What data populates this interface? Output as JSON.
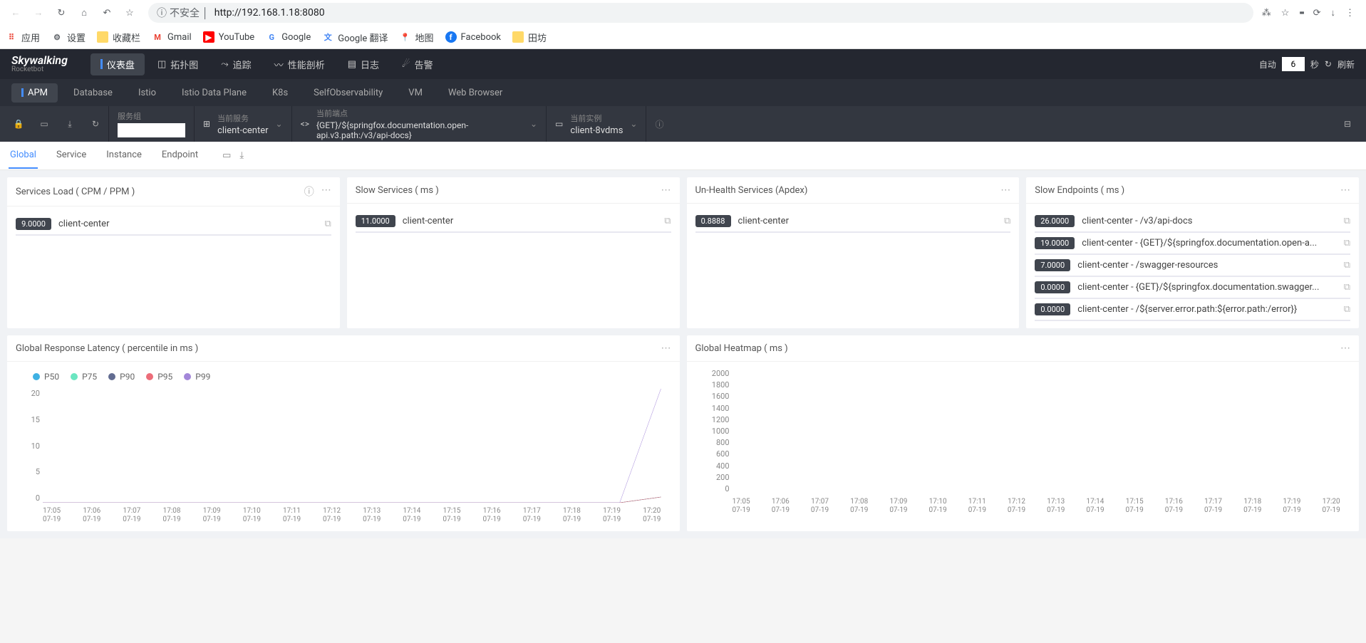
{
  "browser": {
    "insecure_label": "不安全",
    "url": "http://192.168.1.18:8080",
    "bookmarks": {
      "apps": "应用",
      "settings": "设置",
      "favorites": "收藏栏",
      "gmail": "Gmail",
      "youtube": "YouTube",
      "google": "Google",
      "gtranslate": "Google 翻译",
      "map": "地图",
      "facebook": "Facebook",
      "tiantan": "田坊"
    }
  },
  "header": {
    "logo_main": "Skywalking",
    "logo_sub": "Rocketbot",
    "tabs": {
      "dashboard": "仪表盘",
      "topology": "拓扑图",
      "trace": "追踪",
      "profile": "性能剖析",
      "log": "日志",
      "alarm": "告警"
    },
    "auto_label": "自动",
    "interval_value": "6",
    "seconds_label": "秒",
    "refresh_label": "刷新"
  },
  "subnav": {
    "apm": "APM",
    "database": "Database",
    "istio": "Istio",
    "istio_dp": "Istio Data Plane",
    "k8s": "K8s",
    "self": "SelfObservability",
    "vm": "VM",
    "web": "Web Browser"
  },
  "selectors": {
    "group_label": "服务组",
    "group_value": "",
    "service_label": "当前服务",
    "service_value": "client-center",
    "endpoint_label": "当前端点",
    "endpoint_value": "{GET}/${springfox.documentation.open-api.v3.path:/v3/api-docs}",
    "instance_label": "当前实例",
    "instance_value": "client-8vdms"
  },
  "page_tabs": {
    "global": "Global",
    "service": "Service",
    "instance": "Instance",
    "endpoint": "Endpoint"
  },
  "cards": {
    "services_load": {
      "title": "Services Load ( CPM / PPM )",
      "items": [
        {
          "value": "9.0000",
          "name": "client-center",
          "pct": 100
        }
      ]
    },
    "slow_services": {
      "title": "Slow Services ( ms )",
      "items": [
        {
          "value": "11.0000",
          "name": "client-center",
          "pct": 100
        }
      ]
    },
    "unhealth": {
      "title": "Un-Health Services (Apdex)",
      "items": [
        {
          "value": "0.8888",
          "name": "client-center",
          "pct": 100
        }
      ]
    },
    "slow_endpoints": {
      "title": "Slow Endpoints ( ms )",
      "items": [
        {
          "value": "26.0000",
          "name": "client-center - /v3/api-docs",
          "pct": 100
        },
        {
          "value": "19.0000",
          "name": "client-center - {GET}/${springfox.documentation.open-a...",
          "pct": 73
        },
        {
          "value": "7.0000",
          "name": "client-center - /swagger-resources",
          "pct": 27
        },
        {
          "value": "0.0000",
          "name": "client-center - {GET}/${springfox.documentation.swagger...",
          "pct": 0
        },
        {
          "value": "0.0000",
          "name": "client-center - /${server.error.path:${error.path:/error}}",
          "pct": 0
        }
      ]
    },
    "latency": {
      "title": "Global Response Latency ( percentile in ms )"
    },
    "heatmap": {
      "title": "Global Heatmap ( ms )"
    }
  },
  "chart_data": [
    {
      "type": "line",
      "title": "Global Response Latency ( percentile in ms )",
      "xlabel": "",
      "ylabel": "",
      "ylim": [
        0,
        20
      ],
      "categories": [
        "17:05 07-19",
        "17:06 07-19",
        "17:07 07-19",
        "17:08 07-19",
        "17:09 07-19",
        "17:10 07-19",
        "17:11 07-19",
        "17:12 07-19",
        "17:13 07-19",
        "17:14 07-19",
        "17:15 07-19",
        "17:16 07-19",
        "17:17 07-19",
        "17:18 07-19",
        "17:19 07-19",
        "17:20 07-19"
      ],
      "series": [
        {
          "name": "P50",
          "color": "#3fb1e3",
          "values": [
            0,
            0,
            0,
            0,
            0,
            0,
            0,
            0,
            0,
            0,
            0,
            0,
            0,
            0,
            0,
            1
          ]
        },
        {
          "name": "P75",
          "color": "#6be6c1",
          "values": [
            0,
            0,
            0,
            0,
            0,
            0,
            0,
            0,
            0,
            0,
            0,
            0,
            0,
            0,
            0,
            1
          ]
        },
        {
          "name": "P90",
          "color": "#626c91",
          "values": [
            0,
            0,
            0,
            0,
            0,
            0,
            0,
            0,
            0,
            0,
            0,
            0,
            0,
            0,
            0,
            1
          ]
        },
        {
          "name": "P95",
          "color": "#ec6d79",
          "values": [
            0,
            0,
            0,
            0,
            0,
            0,
            0,
            0,
            0,
            0,
            0,
            0,
            0,
            0,
            0,
            1
          ]
        },
        {
          "name": "P99",
          "color": "#a387d9",
          "values": [
            0,
            0,
            0,
            0,
            0,
            0,
            0,
            0,
            0,
            0,
            0,
            0,
            0,
            0,
            0,
            20
          ]
        }
      ]
    },
    {
      "type": "heatmap",
      "title": "Global Heatmap ( ms )",
      "ylim": [
        0,
        2000
      ],
      "y_ticks": [
        2000,
        1800,
        1600,
        1400,
        1200,
        1000,
        800,
        600,
        400,
        200,
        0
      ],
      "categories": [
        "17:05 07-19",
        "17:06 07-19",
        "17:07 07-19",
        "17:08 07-19",
        "17:09 07-19",
        "17:10 07-19",
        "17:11 07-19",
        "17:12 07-19",
        "17:13 07-19",
        "17:14 07-19",
        "17:15 07-19",
        "17:16 07-19",
        "17:17 07-19",
        "17:18 07-19",
        "17:19 07-19",
        "17:20 07-19"
      ],
      "values": []
    }
  ]
}
